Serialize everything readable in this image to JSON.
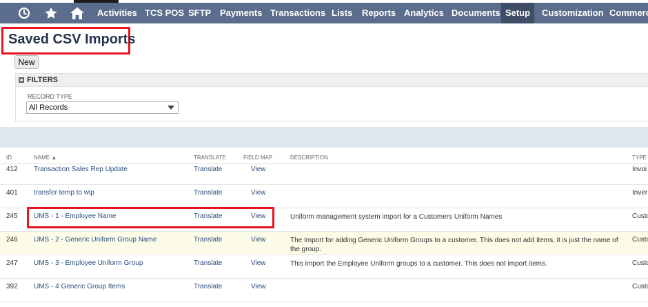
{
  "nav": {
    "icons": [
      {
        "name": "recent-history-icon",
        "glyph": "◔"
      },
      {
        "name": "star-icon",
        "glyph": "★"
      },
      {
        "name": "home-icon",
        "glyph": "⌂"
      }
    ],
    "items": [
      "Activities",
      "TCS POS",
      "SFTP",
      "Payments",
      "Transactions",
      "Lists",
      "Reports",
      "Analytics",
      "Documents",
      "Setup",
      "Customization",
      "Commerce"
    ],
    "active_item": "Setup"
  },
  "page": {
    "title": "Saved CSV Imports",
    "new_button": "New"
  },
  "filters": {
    "title": "FILTERS",
    "record_type_label": "RECORD TYPE",
    "record_type_value": "All Records"
  },
  "table": {
    "headers": {
      "id": "ID",
      "name": "NAME ▲",
      "translate": "TRANSLATE",
      "field_map": "FIELD MAP",
      "description": "DESCRIPTION",
      "type": "TYPE"
    },
    "rows": [
      {
        "id": "412",
        "name": "Transaction Sales Rep Update",
        "translate": "Translate",
        "field_map": "View",
        "description": "",
        "type": "Invoi"
      },
      {
        "id": "401",
        "name": "transfer temp to wip",
        "translate": "Translate",
        "field_map": "View",
        "description": "",
        "type": "Inver"
      },
      {
        "id": "245",
        "name": "UMS - 1 - Employee Name",
        "translate": "Translate",
        "field_map": "View",
        "description": "Uniform management system import for a Customers Uniform Names",
        "type": "Custo"
      },
      {
        "id": "246",
        "name": "UMS - 2 - Generic Uniform Group Name",
        "translate": "Translate",
        "field_map": "View",
        "description": "The Import for adding Generic Uniform Groups to a customer. This does not add items, it is just the name of the group.",
        "type": "Custo"
      },
      {
        "id": "247",
        "name": "UMS - 3 - Employee Uniform Group",
        "translate": "Translate",
        "field_map": "View",
        "description": "This import the Employee Uniform groups to a customer. This does not import items.",
        "type": "Custo"
      },
      {
        "id": "392",
        "name": "UMS - 4 Generic Group Items",
        "translate": "Translate",
        "field_map": "View",
        "description": "",
        "type": "Custo"
      }
    ]
  },
  "colors": {
    "nav_bg": "#5b6d8c",
    "nav_active": "#3f4d66",
    "highlight": "#e8141b",
    "link": "#2a4e7e"
  }
}
